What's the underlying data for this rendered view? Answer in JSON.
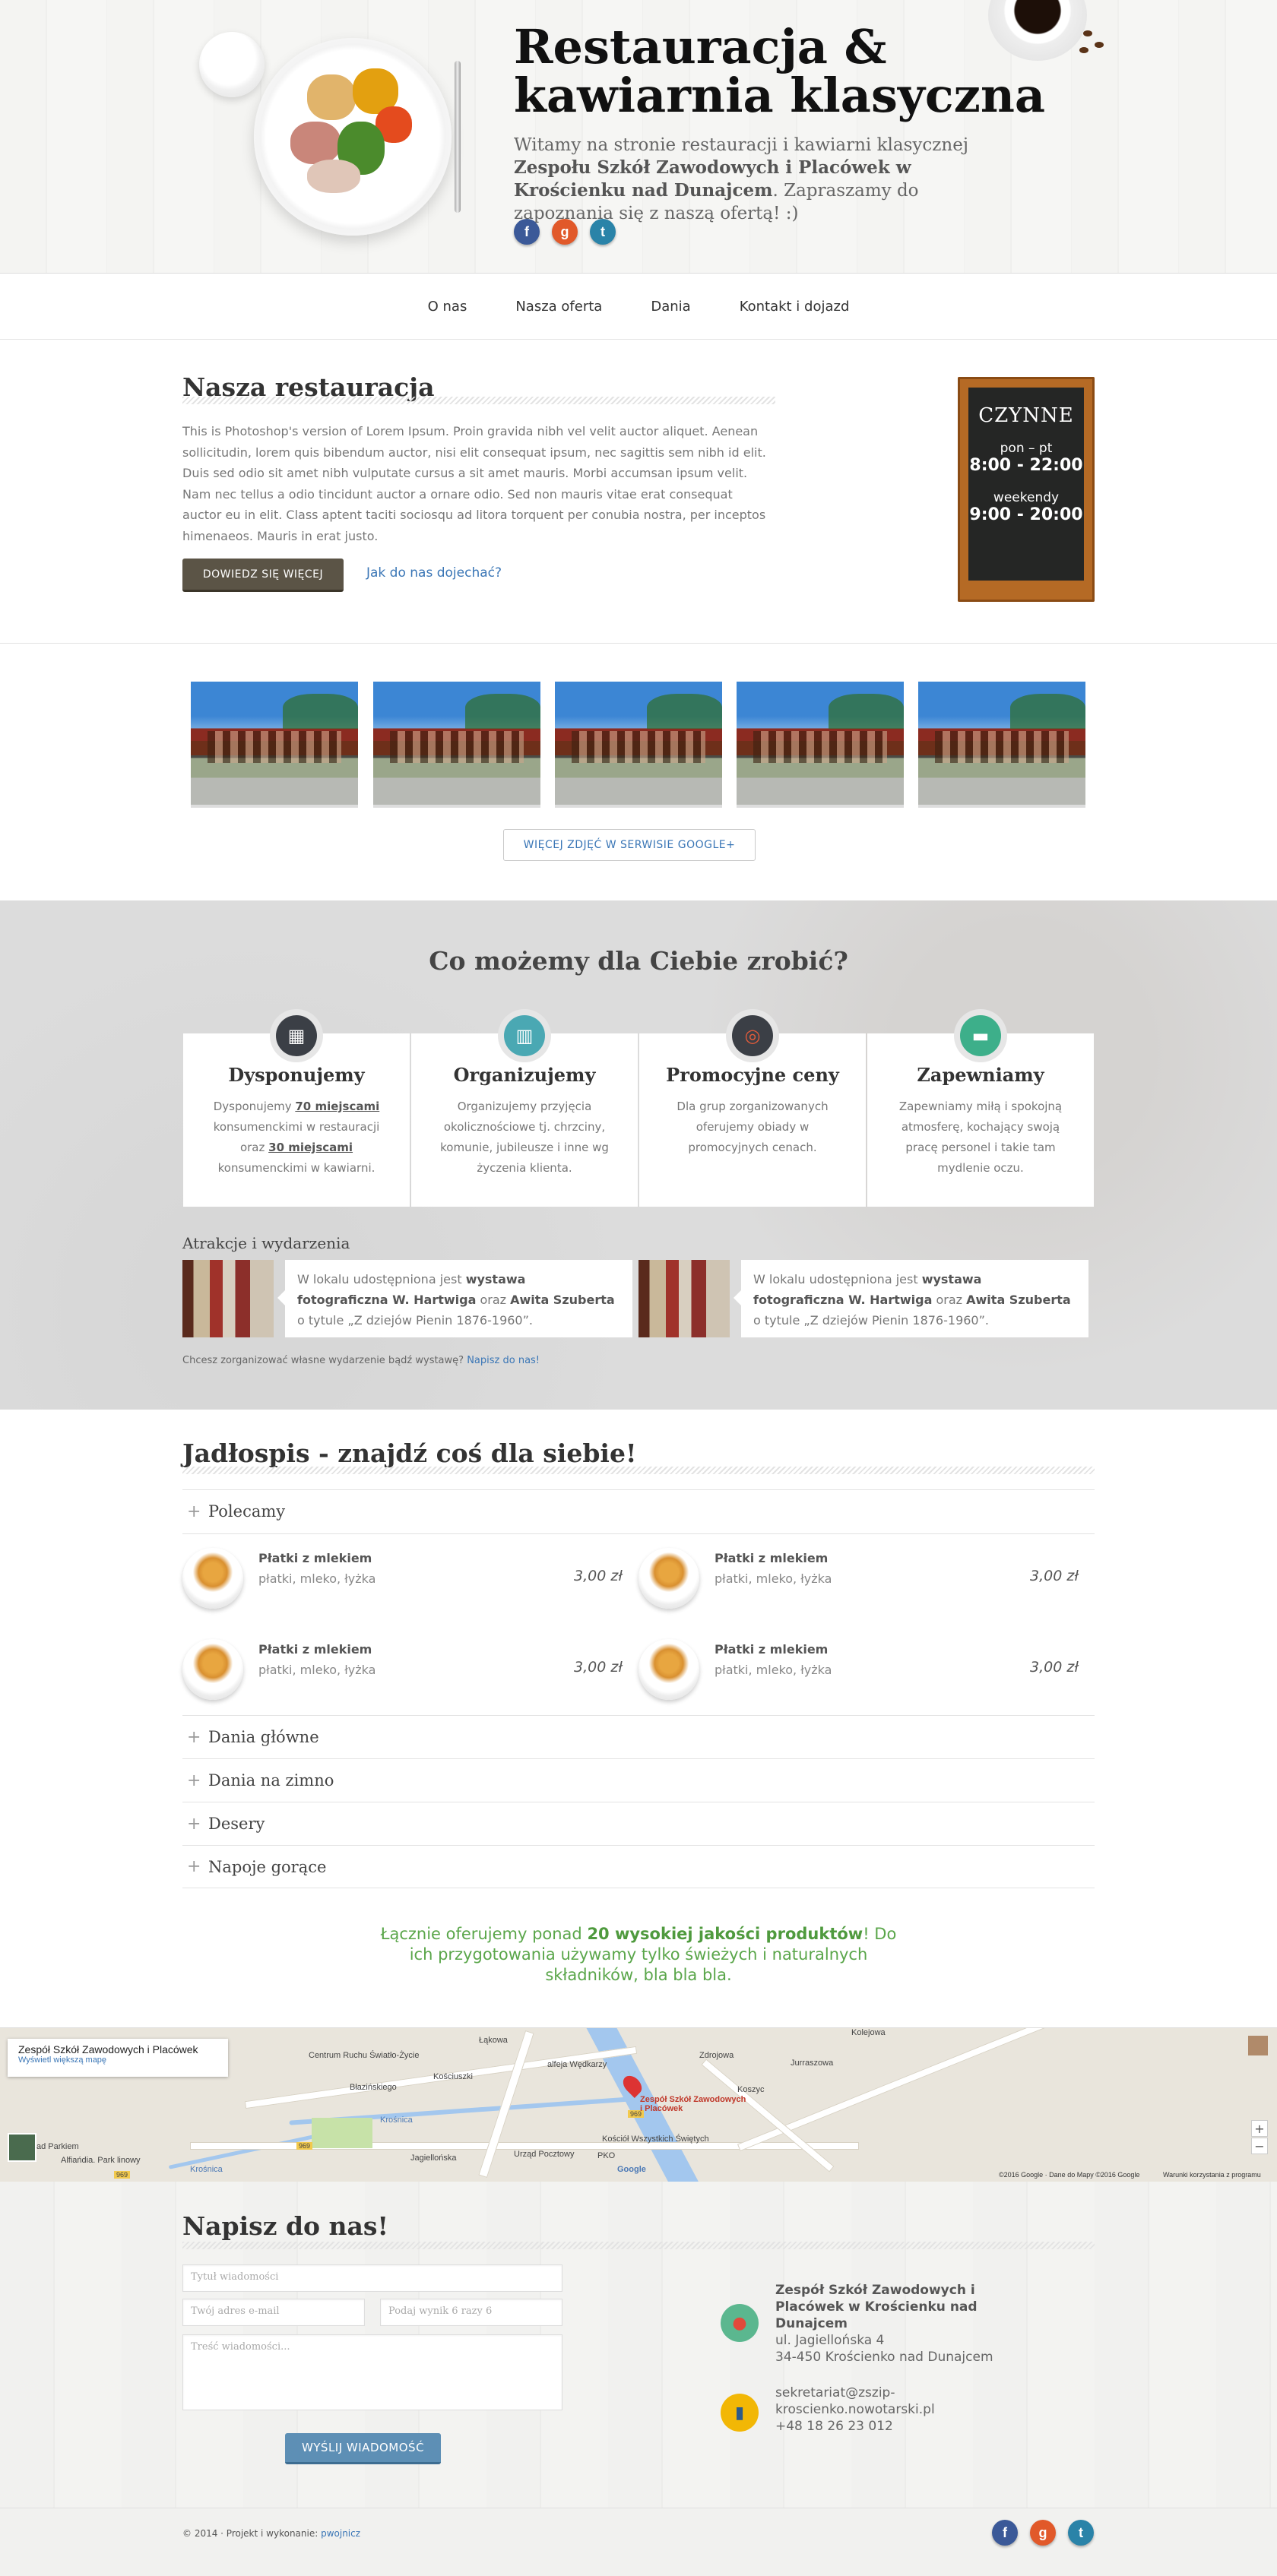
{
  "header": {
    "title_line1": "Restauracja &",
    "title_line2": "kawiarnia klasyczna",
    "desc_prefix": "Witamy na stronie restauracji i kawiarni klasycznej ",
    "desc_school": "Zespołu Szkół Zawodowych i Placówek w Krościenku nad Dunajcem",
    "desc_suffix": ". Zapraszamy do zapoznania się z naszą ofertą! :)",
    "social": [
      {
        "name": "facebook-icon",
        "glyph": "f"
      },
      {
        "name": "google-plus-icon",
        "glyph": "g"
      },
      {
        "name": "twitter-icon",
        "glyph": "t"
      }
    ]
  },
  "nav": {
    "items": [
      "O nas",
      "Nasza oferta",
      "Dania",
      "Kontakt i dojazd"
    ]
  },
  "about": {
    "title": "Nasza restauracja",
    "text": "This is Photoshop's version of Lorem Ipsum. Proin gravida nibh vel velit auctor aliquet. Aenean sollicitudin, lorem quis bibendum auctor, nisi elit consequat ipsum, nec sagittis sem nibh id elit. Duis sed odio sit amet nibh vulputate cursus a sit amet mauris. Morbi accumsan ipsum velit. Nam nec tellus a odio tincidunt auctor a ornare odio. Sed non mauris vitae erat consequat auctor eu in elit. Class aptent taciti sociosqu ad litora torquent per conubia nostra, per inceptos himenaeos. Mauris in erat justo.",
    "more_button": "DOWIEDZ SIĘ WIĘCEJ",
    "directions_link": "Jak do nas dojechać?",
    "board": {
      "status": "CZYNNE",
      "days1": "pon – pt",
      "hours1": "8:00 - 22:00",
      "days2": "weekendy",
      "hours2": "9:00 - 20:00"
    }
  },
  "gallery": {
    "more_button": "WIĘCEJ ZDJĘĆ W SERWISIE GOOGLE+"
  },
  "services": {
    "title": "Co możemy dla Ciebie zrobić?",
    "cards": [
      {
        "icon": "abacus-icon",
        "color": "#3b3f46",
        "title": "Dysponujemy",
        "t1": "Dysponujemy ",
        "b1": "70 miejscami",
        "t2": " konsumenckimi w restauracji oraz ",
        "b2": "30 miejscami",
        "t3": " konsumenckimi w kawiarni."
      },
      {
        "icon": "gift-icon",
        "color": "#4aa8b3",
        "title": "Organizujemy",
        "t1": "Organizujemy przyjęcia okolicznościowe tj. chrzciny, komunie, jubileusze i inne wg życzenia klienta.",
        "b1": "",
        "t2": "",
        "b2": "",
        "t3": ""
      },
      {
        "icon": "target-icon",
        "color": "#3b3f46",
        "title": "Promocyjne ceny",
        "t1": "Dla grup zorganizowanych oferujemy obiady w promocyjnych cenach.",
        "b1": "",
        "t2": "",
        "b2": "",
        "t3": ""
      },
      {
        "icon": "sofa-icon",
        "color": "#3daf8a",
        "title": "Zapewniamy",
        "t1": "Zapewniamy miłą i spokojną atmosferę, kochający swoją pracę personel i takie tam mydlenie oczu.",
        "b1": "",
        "t2": "",
        "b2": "",
        "t3": ""
      }
    ],
    "events_title": "Atrakcje i wydarzenia",
    "events": [
      {
        "t1": "W lokalu udostępniona jest ",
        "b1": "wystawa fotograficzna W. Hartwiga",
        "t2": " oraz ",
        "b2": "Awita Szuberta",
        "t3": " o tytule „Z dziejów Pienin 1876-1960”."
      },
      {
        "t1": "W lokalu udostępniona jest ",
        "b1": "wystawa fotograficzna W. Hartwiga",
        "t2": " oraz ",
        "b2": "Awita Szuberta",
        "t3": " o tytule „Z dziejów Pienin 1876-1960”."
      }
    ],
    "events_note": "Chcesz zorganizować własne wydarzenie bądź wystawę? ",
    "events_note_link": "Napisz do nas!"
  },
  "menu": {
    "title": "Jadłospis - znajdź coś dla siebie!",
    "categories": [
      "Polecamy",
      "Dania główne",
      "Dania na zimno",
      "Desery",
      "Napoje gorące"
    ],
    "dishes": [
      {
        "name": "Płatki z mlekiem",
        "desc": "płatki, mleko, łyżka",
        "price": "3,00 zł"
      },
      {
        "name": "Płatki z mlekiem",
        "desc": "płatki, mleko, łyżka",
        "price": "3,00 zł"
      },
      {
        "name": "Płatki z mlekiem",
        "desc": "płatki, mleko, łyżka",
        "price": "3,00 zł"
      },
      {
        "name": "Płatki z mlekiem",
        "desc": "płatki, mleko, łyżka",
        "price": "3,00 zł"
      }
    ],
    "promo_prefix": "Łącznie oferujemy ponad ",
    "promo_bold": "20 wysokiej jakości produktów",
    "promo_suffix": "! Do ich przygotowania używamy tylko świeżych i naturalnych składników, bla bla bla."
  },
  "map": {
    "info_title": "Zespół Szkół Zawodowych i Placówek",
    "info_link": "Wyświetl większą mapę",
    "pin_label": "Zespół Szkół Zawodowych i Placówek",
    "labels": [
      "Centrum Ruchu Światło-Życie",
      "Błazińskiego",
      "Kościuszki",
      "alfeja Wędkarzy",
      "Jagiellońska",
      "Krośnica",
      "Urząd Pocztowy",
      "Kościół Wszystkich Świętych",
      "PKO",
      "Zdrojowa",
      "Jurraszowa",
      "Kolejowa",
      "Krośnica",
      "Alfiańdia. Park linowy",
      "ad Parkiem",
      "Łąkowa",
      "Koszyc"
    ],
    "road_nums": [
      "969",
      "969",
      "969"
    ],
    "copyright": "©2016 Google · Dane do Mapy ©2016 Google",
    "terms": "Warunki korzystania z programu",
    "zoom_in": "+",
    "zoom_out": "−",
    "google_logo": "Google"
  },
  "contact": {
    "title": "Napisz do nas!",
    "title_placeholder": "Tytuł wiadomości",
    "email_placeholder": "Twój adres e-mail",
    "captcha_placeholder": "Podaj wynik 6 razy 6",
    "message_placeholder": "Treść wiadomości...",
    "send_button": "WYŚLIJ WIADOMOŚĆ",
    "org_name": "Zespół Szkół Zawodowych i Placówek w Krościenku nad Dunajcem",
    "address1": "ul. Jagiellońska 4",
    "address2": "34-450 Krościenko nad Dunajcem",
    "email": "sekretariat@zszip-kroscienko.nowotarski.pl",
    "phone": "+48 18 26 23 012"
  },
  "footer": {
    "copyright": "© 2014 · Projekt i wykonanie: ",
    "author": "pwojnicz"
  }
}
